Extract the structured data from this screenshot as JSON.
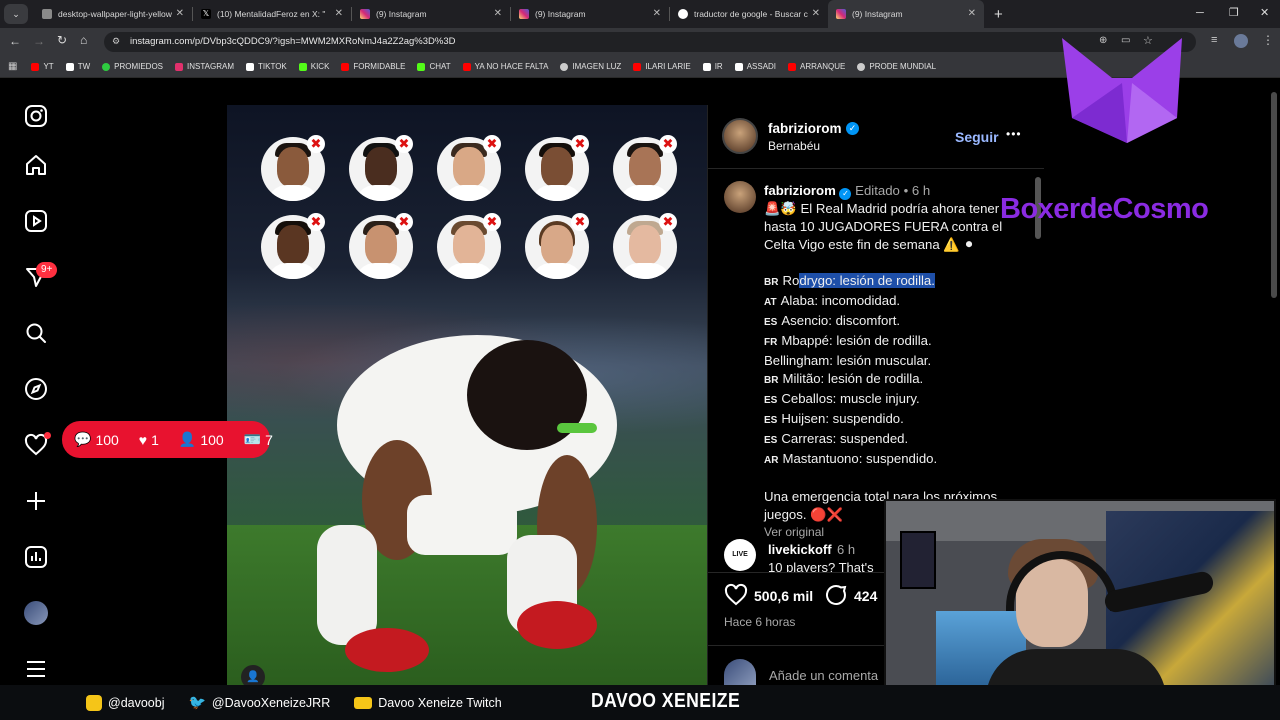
{
  "browser": {
    "tabs": [
      {
        "title": "desktop-wallpaper-light-yellow",
        "color": "#8a8a8a"
      },
      {
        "title": "(10) MentalidadFeroz en X: \"",
        "color": "#ffffff"
      },
      {
        "title": "(9) Instagram",
        "color": "#e1306c"
      },
      {
        "title": "(9) Instagram",
        "color": "#e1306c"
      },
      {
        "title": "traductor de google - Buscar c",
        "color": "#4285f4"
      },
      {
        "title": "(9) Instagram",
        "color": "#e1306c"
      }
    ],
    "new_tab": "+",
    "url": "instagram.com/p/DVbp3cQDDC9/?igsh=MWM2MXRoNmJ4a2Z2ag%3D%3D",
    "bookmarks": [
      {
        "label": "YT",
        "color": "#ff0000"
      },
      {
        "label": "TW",
        "color": "#ffffff"
      },
      {
        "label": "PROMIEDOS",
        "color": "#2ecc40"
      },
      {
        "label": "INSTAGRAM",
        "color": "#e1306c"
      },
      {
        "label": "TIKTOK",
        "color": "#ffffff"
      },
      {
        "label": "KICK",
        "color": "#53fc18"
      },
      {
        "label": "FORMIDABLE",
        "color": "#ff0000"
      },
      {
        "label": "CHAT",
        "color": "#53fc18"
      },
      {
        "label": "YA NO HACE FALTA",
        "color": "#ff0000"
      },
      {
        "label": "IMAGEN LUZ",
        "color": "#cccccc"
      },
      {
        "label": "ILARI LARIE",
        "color": "#ff0000"
      },
      {
        "label": "IR",
        "color": "#ffffff"
      },
      {
        "label": "ASSADI",
        "color": "#ffffff"
      },
      {
        "label": "ARRANQUE",
        "color": "#ff0000"
      },
      {
        "label": "PRODE MUNDIAL",
        "color": "#cccccc"
      }
    ]
  },
  "sidebar": {
    "notification_badge": "9+"
  },
  "stream_overlay": {
    "comments": "100",
    "likes": "1",
    "follows": "100",
    "subs": "7",
    "watermark": "BoxerdeCosmo",
    "footer": {
      "instagram": "@davoobj",
      "twitter": "@DavooXeneizeJRR",
      "twitch": "Davoo Xeneize Twitch",
      "brand": "DAVOO XENEIZE"
    }
  },
  "post": {
    "author": "fabriziorom",
    "location": "Bernabéu",
    "follow": "Seguir",
    "more": "•••",
    "caption_author": "fabriziorom",
    "edited": "Editado",
    "time": "6 h",
    "caption_intro": "🚨🤯 El Real Madrid podría ahora tener hasta 10 JUGADORES FUERA contra el Celta Vigo este fin de semana ⚠️ ⚫",
    "players": [
      {
        "flag": "BR",
        "text_a": "Ro",
        "text_b": "drygo: lesión de rodilla."
      },
      {
        "flag": "AT",
        "text_a": "",
        "text_b": "Alaba: incomodidad."
      },
      {
        "flag": "ES",
        "text_a": "",
        "text_b": "Asencio: discomfort."
      },
      {
        "flag": "FR",
        "text_a": "",
        "text_b": "Mbappé: lesión de rodilla."
      },
      {
        "flag": "",
        "text_a": "",
        "text_b": "Bellingham: lesión muscular."
      },
      {
        "flag": "BR",
        "text_a": "",
        "text_b": "Militão: lesión de rodilla."
      },
      {
        "flag": "ES",
        "text_a": "",
        "text_b": "Ceballos: muscle injury."
      },
      {
        "flag": "ES",
        "text_a": "",
        "text_b": "Huijsen: suspendido."
      },
      {
        "flag": "ES",
        "text_a": "",
        "text_b": "Carreras: suspended."
      },
      {
        "flag": "AR",
        "text_a": "",
        "text_b": "Mastantuono: suspendido."
      }
    ],
    "caption_outro": "Una emergencia total para los próximos juegos. 🔴❌",
    "see_original": "Ver original",
    "comment_author": "livekickoff",
    "comment_time": "6 h",
    "comment_text": "10 players? That's",
    "likes": "500,6 mil",
    "comments_count": "424",
    "posted": "Hace 6 horas",
    "add_comment": "Añade un comentario..."
  },
  "colors": {
    "instagram_blue": "#0095f6",
    "follow_text": "#9ab8ff",
    "pill_red": "#e8122f",
    "watermark_purple": "#8a2be2",
    "selection": "#1e4fa8"
  }
}
